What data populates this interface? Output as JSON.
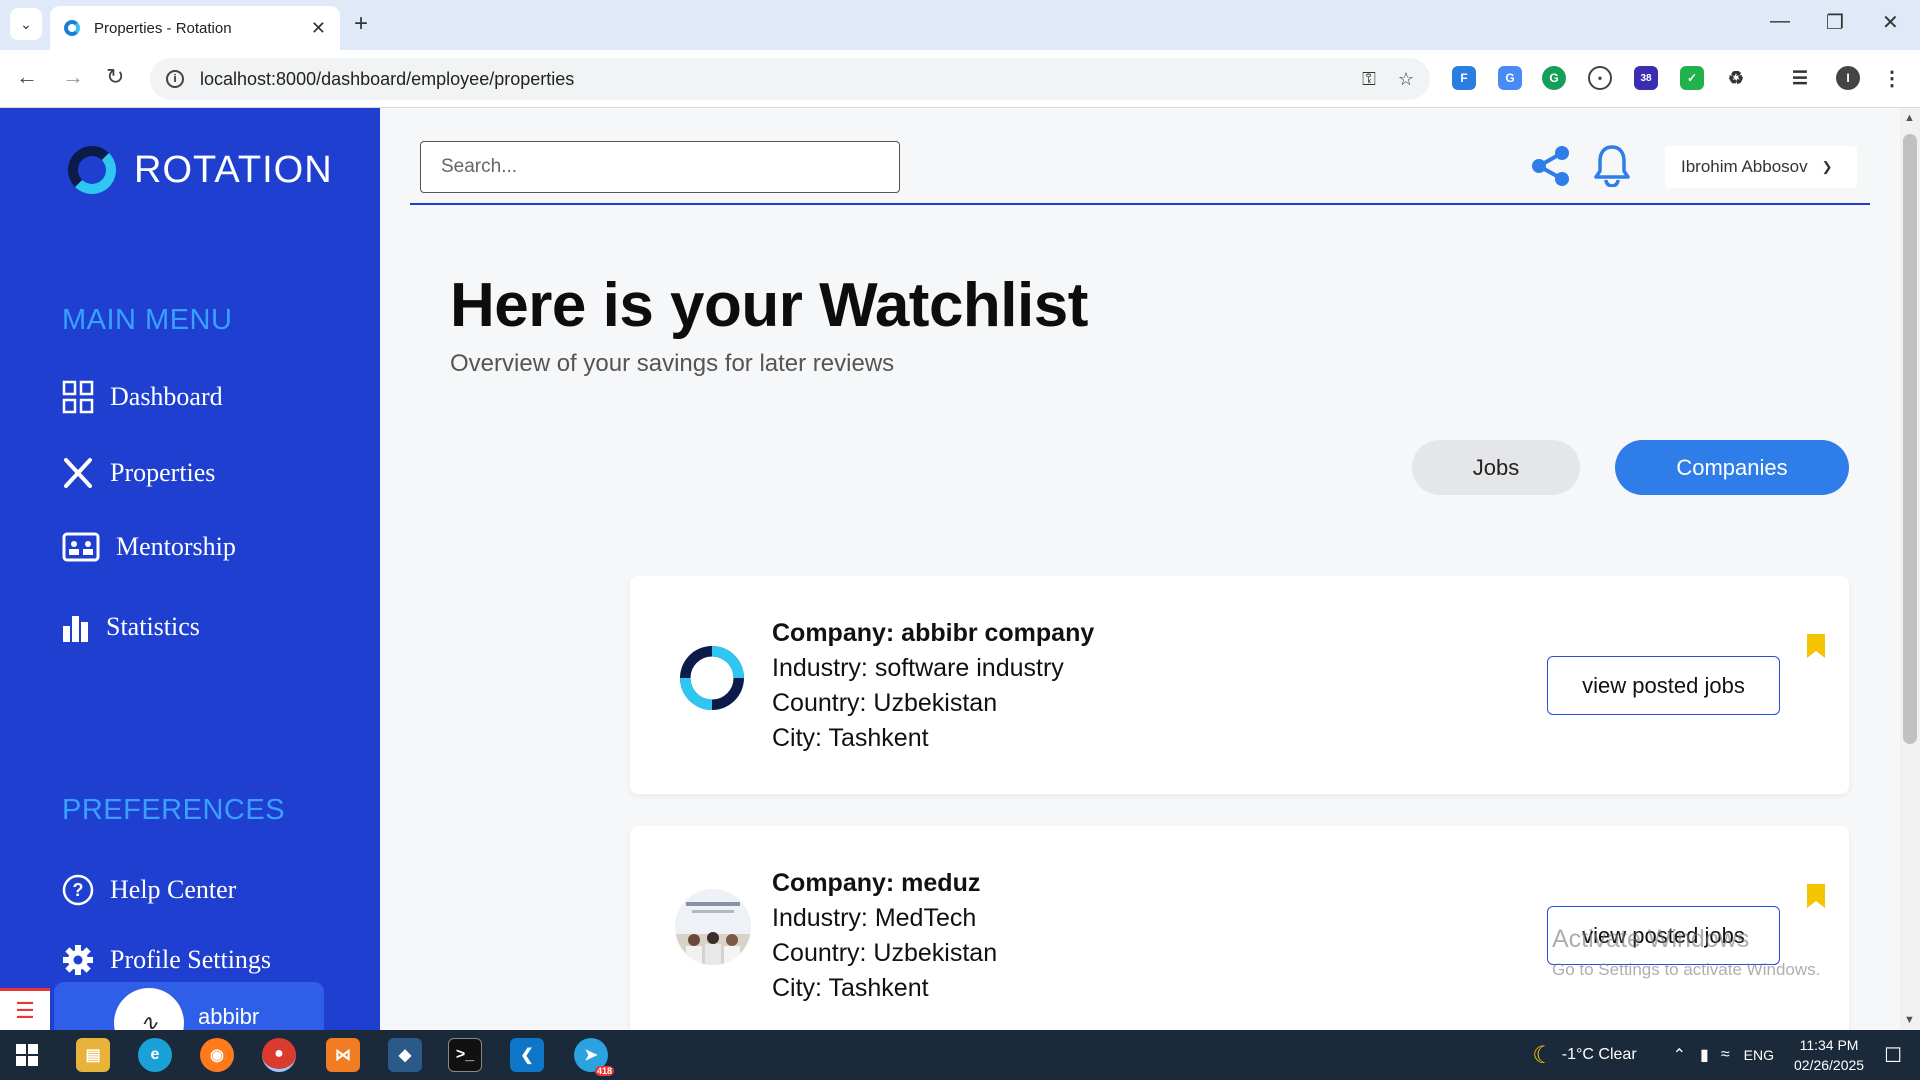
{
  "browser": {
    "tab_title": "Properties - Rotation",
    "url": "localhost:8000/dashboard/employee/properties",
    "ext_badge": "38"
  },
  "sidebar": {
    "brand": "ROTATION",
    "main_menu_label": "MAIN MENU",
    "items": [
      {
        "label": "Dashboard",
        "icon": "grid-icon"
      },
      {
        "label": "Properties",
        "icon": "tools-icon"
      },
      {
        "label": "Mentorship",
        "icon": "mentorship-icon"
      },
      {
        "label": "Statistics",
        "icon": "bar-chart-icon"
      }
    ],
    "preferences_label": "PREFERENCES",
    "pref_items": [
      {
        "label": "Help Center",
        "icon": "help-icon"
      },
      {
        "label": "Profile Settings",
        "icon": "gear-icon"
      }
    ],
    "user_name": "abbibr"
  },
  "header": {
    "search_placeholder": "Search...",
    "user_dropdown": "Ibrohim Abbosov"
  },
  "main": {
    "title": "Here is your Watchlist",
    "subtitle": "Overview of your savings for later reviews",
    "tabs": [
      {
        "label": "Jobs",
        "active": false
      },
      {
        "label": "Companies",
        "active": true
      }
    ],
    "companies": [
      {
        "company": "Company: abbibr company",
        "industry": "Industry: software industry",
        "country": "Country: Uzbekistan",
        "city": "City: Tashkent",
        "button": "view posted jobs"
      },
      {
        "company": "Company: meduz",
        "industry": "Industry: MedTech",
        "country": "Country: Uzbekistan",
        "city": "City: Tashkent",
        "button": "view posted jobs"
      }
    ]
  },
  "watermark": {
    "line1": "Activate Windows",
    "line2": "Go to Settings to activate Windows."
  },
  "taskbar": {
    "weather": "-1°C  Clear",
    "lang": "ENG",
    "time": "11:34 PM",
    "date": "02/26/2025",
    "telegram_badge": "418"
  },
  "colors": {
    "sidebar": "#1e3fd0",
    "accent": "#2f7de8",
    "bookmark": "#f5c400"
  }
}
